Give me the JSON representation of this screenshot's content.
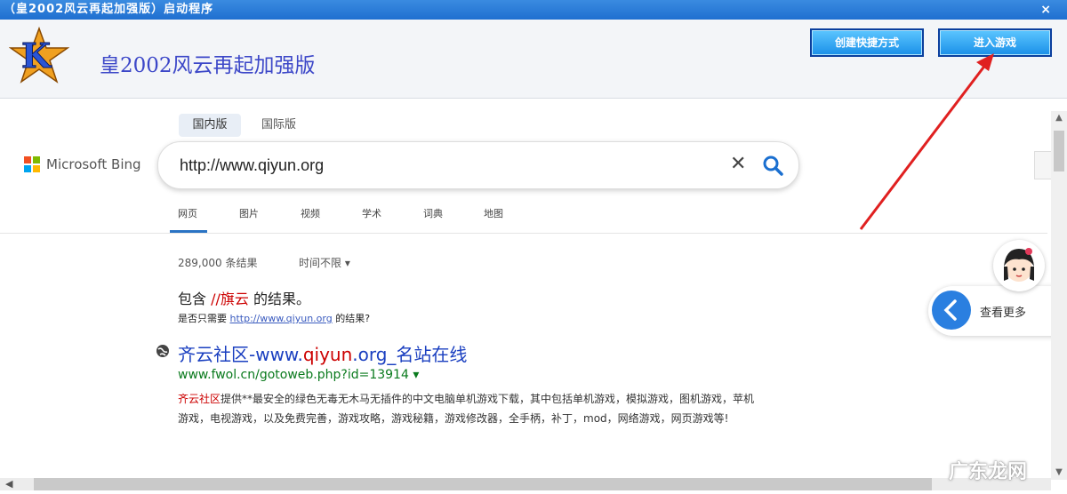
{
  "window": {
    "title": "（皇2002风云再起加强版）启动程序",
    "close_glyph": "×"
  },
  "launcher": {
    "app_name": "皇2002风云再起加强版",
    "buttons": {
      "create_shortcut": "创建快捷方式",
      "enter_game": "进入游戏"
    }
  },
  "bing": {
    "region_tabs": [
      "国内版",
      "国际版"
    ],
    "brand": "Microsoft Bing",
    "search_value": "http://www.qiyun.org",
    "clear_glyph": "✕",
    "nav_tabs": [
      "网页",
      "图片",
      "视频",
      "学术",
      "词典",
      "地图"
    ],
    "result_count": "289,000 条结果",
    "time_filter": "时间不限",
    "time_filter_arrow": "▾",
    "suggest_prefix": "包含 ",
    "suggest_highlight": "//旗云",
    "suggest_suffix": " 的结果。",
    "suggest_question_prefix": "是否只需要 ",
    "suggest_question_link": "http://www.qiyun.org",
    "suggest_question_suffix": " 的结果?",
    "result": {
      "title_prefix": "齐云社区-www.",
      "title_highlight": "qiyun",
      "title_suffix": ".org_名站在线",
      "url": "www.fwol.cn/gotoweb.php?id=13914",
      "url_arrow": "▾",
      "desc_highlight": "齐云社区",
      "desc_text": "提供**最安全的绿色无毒无木马无插件的中文电脑单机游戏下载，其中包括单机游戏，模拟游戏，图机游戏，苹机游戏，电视游戏，以及免费完善，游戏攻略，游戏秘籍，游戏修改器，全手柄，补丁，mod，网络游戏，网页游戏等!"
    },
    "more_label": "查看更多"
  },
  "scroll_left_glyph": "◀",
  "scroll_up_glyph": "▲",
  "scroll_down_glyph": "▼",
  "watermark": "广东龙网",
  "colors": {
    "titlebar": "#1f6fd0",
    "button": "#1a8fe8",
    "accent_red": "#e02020"
  }
}
